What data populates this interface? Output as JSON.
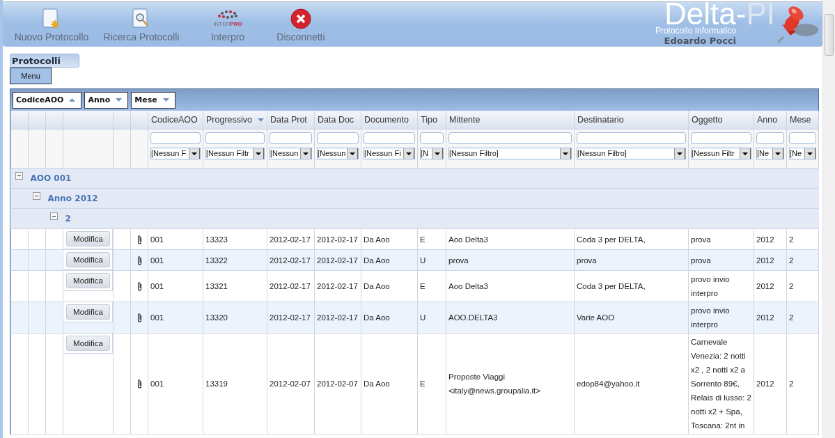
{
  "toolbar": [
    {
      "kind": "new",
      "label": "Nuovo Protocollo"
    },
    {
      "kind": "search",
      "label": "Ricerca Protocolli"
    },
    {
      "kind": "interpro",
      "label": "Interpro",
      "logo_text": [
        "INTER",
        "PRO"
      ]
    },
    {
      "kind": "disconnect",
      "label": "Disconnetti"
    }
  ],
  "brand": {
    "name": "Delta-",
    "suffix": "PI",
    "subtitle": "Protocollo Informatico",
    "user": "Edoardo Pocci"
  },
  "panel": {
    "title": "Protocolli",
    "menu_button": "Menu"
  },
  "group_by": [
    {
      "label": "CodiceAOO",
      "ascending": true
    },
    {
      "label": "Anno",
      "ascending": false
    },
    {
      "label": "Mese",
      "ascending": false
    }
  ],
  "columns": [
    {
      "label": "CodiceAOO",
      "filter": "[Nessun F"
    },
    {
      "label": "Progressivo",
      "sorted": true,
      "ascending": false,
      "filter": "[Nessun Filtr"
    },
    {
      "label": "Data Prot",
      "filter": "[Nessun"
    },
    {
      "label": "Data Doc",
      "filter": "[Nessun"
    },
    {
      "label": "Documento",
      "filter": "[Nessun Fi"
    },
    {
      "label": "Tipo",
      "filter": "[N"
    },
    {
      "label": "Mittente",
      "filter": "[Nessun Filtro]"
    },
    {
      "label": "Destinatario",
      "filter": "[Nessun Filtro]"
    },
    {
      "label": "Oggetto",
      "filter": "[Nessun Filtr"
    },
    {
      "label": "Anno",
      "filter": "[Ne"
    },
    {
      "label": "Mese",
      "filter": "[Ne"
    }
  ],
  "groups": [
    {
      "label": "AOO 001",
      "expanded": true,
      "children": [
        {
          "label": "Anno 2012",
          "expanded": true,
          "children": [
            {
              "label": "2",
              "expanded": true,
              "rows": [
                {
                  "action": "Modifica",
                  "attachment": true,
                  "cells": [
                    "001",
                    "13323",
                    "2012-02-17",
                    "2012-02-17",
                    "Da Aoo",
                    "E",
                    "Aoo Delta3",
                    "Coda 3 per DELTA,",
                    "prova",
                    "2012",
                    "2"
                  ]
                },
                {
                  "action": "Modifica",
                  "attachment": true,
                  "cells": [
                    "001",
                    "13322",
                    "2012-02-17",
                    "2012-02-17",
                    "Da Aoo",
                    "U",
                    "prova",
                    "prova",
                    "prova",
                    "2012",
                    "2"
                  ]
                },
                {
                  "action": "Modifica",
                  "attachment": true,
                  "cells": [
                    "001",
                    "13321",
                    "2012-02-17",
                    "2012-02-17",
                    "Da Aoo",
                    "E",
                    "Aoo Delta3",
                    "Coda 3 per DELTA,",
                    "provo invio interpro",
                    "2012",
                    "2"
                  ]
                },
                {
                  "action": "Modifica",
                  "attachment": true,
                  "cells": [
                    "001",
                    "13320",
                    "2012-02-17",
                    "2012-02-17",
                    "Da Aoo",
                    "U",
                    "AOO.DELTA3",
                    "Varie AOO",
                    "provo invio interpro",
                    "2012",
                    "2"
                  ]
                },
                {
                  "action": "Modifica",
                  "attachment": true,
                  "cells": [
                    "001",
                    "13319",
                    "2012-02-07",
                    "2012-02-07",
                    "Da Aoo",
                    "E",
                    "Proposte Viaggi <italy@news.groupalia.it>",
                    "edop84@yahoo.it",
                    "Carnevale Venezia: 2 notti x2 , 2 notti x2 a Sorrento 89€, Relais di lusso: 2 notti x2 + Spa, Toscana: 2nt in",
                    "2012",
                    "2"
                  ]
                }
              ]
            }
          ]
        }
      ]
    }
  ]
}
